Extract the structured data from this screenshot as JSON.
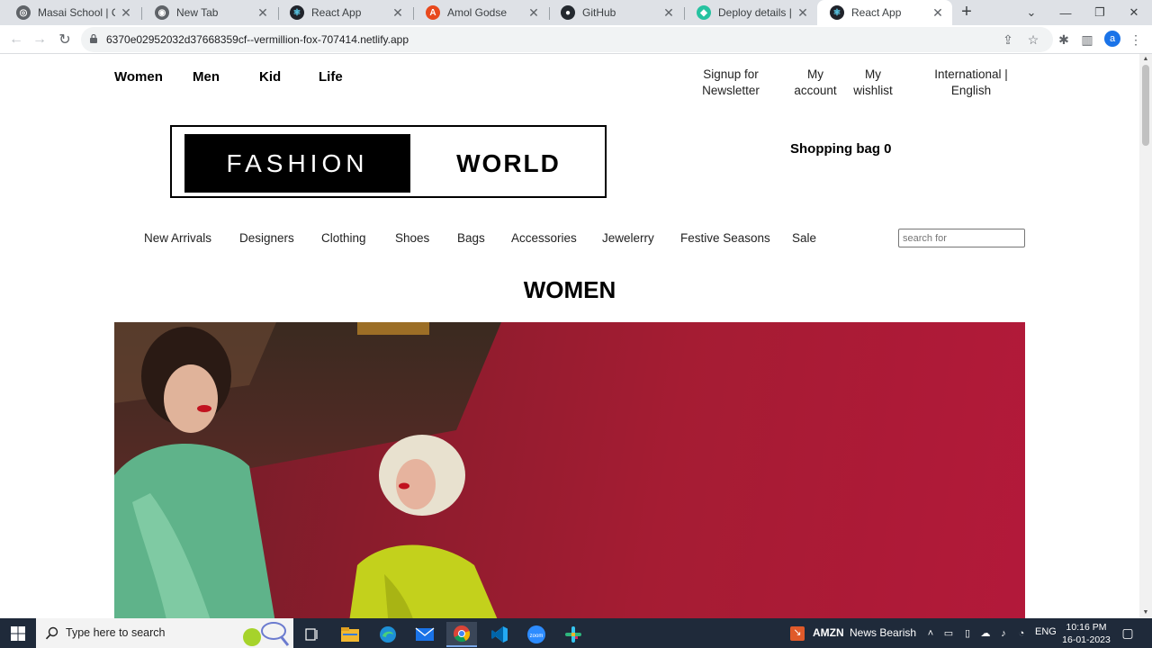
{
  "browser": {
    "tabs": [
      {
        "title": "Masai School | Course",
        "favicon": "masai-icon"
      },
      {
        "title": "New Tab",
        "favicon": "chrome-icon"
      },
      {
        "title": "React App",
        "favicon": "react-icon"
      },
      {
        "title": "Amol Godse",
        "favicon": "avatar-icon"
      },
      {
        "title": "GitHub",
        "favicon": "github-icon"
      },
      {
        "title": "Deploy details | verm",
        "favicon": "netlify-icon"
      },
      {
        "title": "React App",
        "favicon": "react-icon",
        "active": true
      }
    ],
    "url": "6370e02952032d37668359cf--vermillion-fox-707414.netlify.app",
    "profile_initial": "a"
  },
  "page": {
    "topnav": [
      "Women",
      "Men",
      "Kid",
      "Life"
    ],
    "toplinks": {
      "newsletter": [
        "Signup for",
        "Newsletter"
      ],
      "account": [
        "My",
        "account"
      ],
      "wishlist": [
        "My",
        "wishlist"
      ],
      "locale": [
        "International |",
        "English"
      ]
    },
    "logo": {
      "left": "FASHION",
      "right": "WORLD"
    },
    "shopping_bag": "Shopping bag 0",
    "categories": [
      "New Arrivals",
      "Designers",
      "Clothing",
      "Shoes",
      "Bags",
      "Accessories",
      "Jewelerry",
      "Festive Seasons",
      "Sale"
    ],
    "search_placeholder": "search for",
    "title": "WOMEN"
  },
  "taskbar": {
    "search_placeholder": "Type here to search",
    "news_ticker": "AMZN",
    "news_text": "News Bearish",
    "language": "ENG",
    "time": "10:16 PM",
    "date": "16-01-2023"
  },
  "colors": {
    "accent_brand": "#000000",
    "hero_red": "#a51c33",
    "taskbar": "#1f2a3a"
  }
}
